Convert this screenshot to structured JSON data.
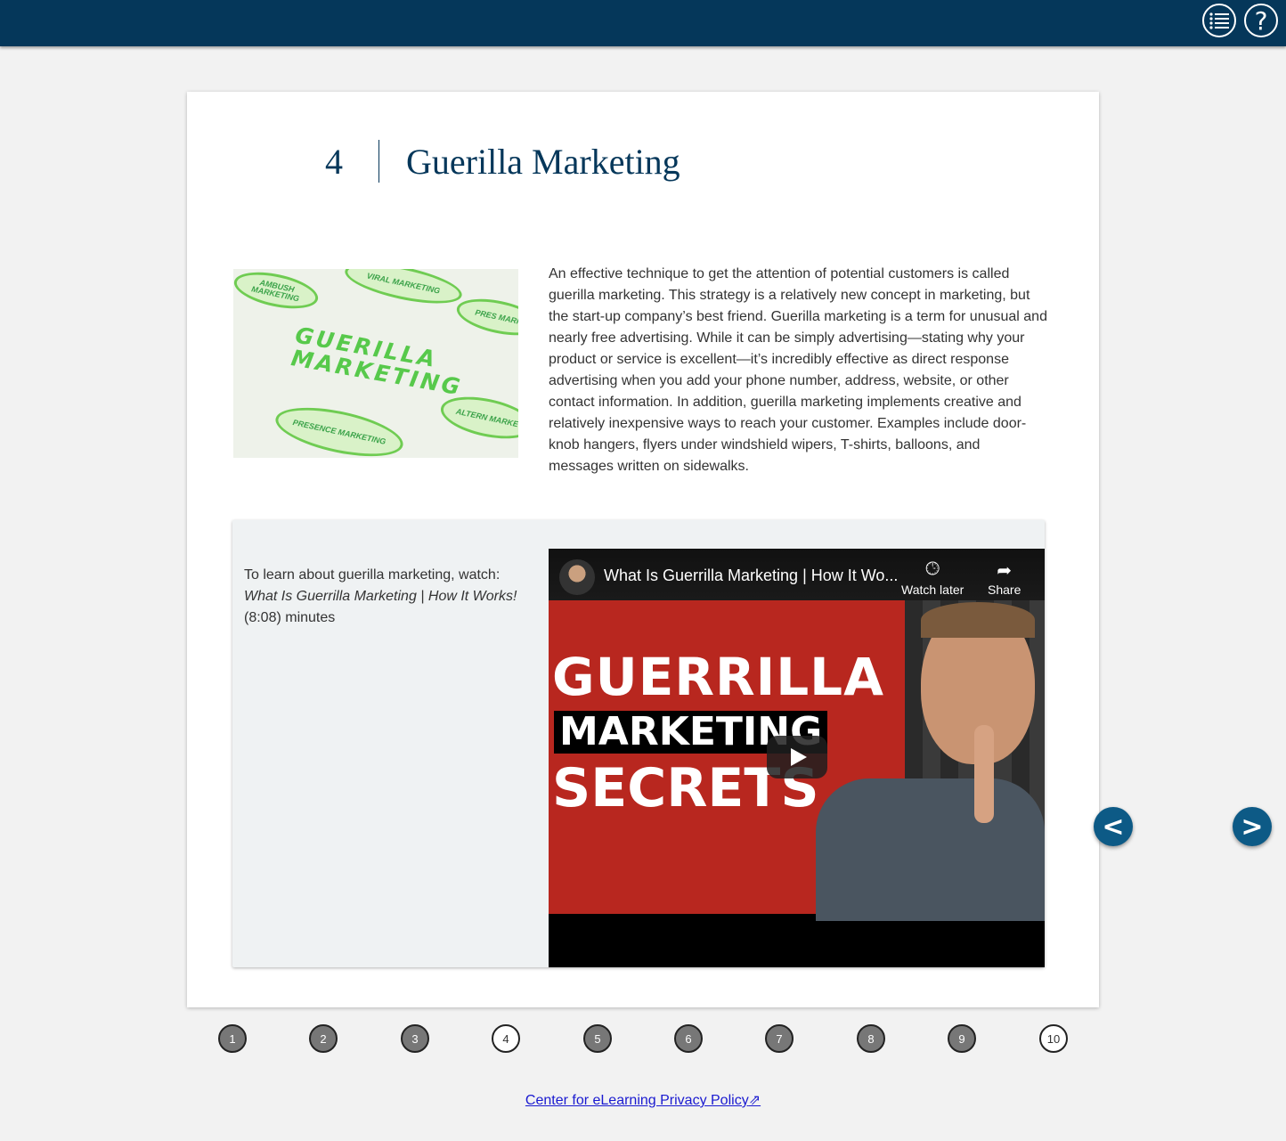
{
  "topbar": {
    "menu_icon": "list-icon",
    "help_label": "?",
    "color": "#05375a"
  },
  "chapter": {
    "number": "4",
    "title": "Guerilla Marketing"
  },
  "hero_image": {
    "main_text_line1": "GUERILLA",
    "main_text_line2": "MARKETING",
    "ovals": [
      "AMBUSH MARKETING",
      "VIRAL MARKETING",
      "PRES MARK",
      "PRESENCE MARKETING",
      "ALTERN MARKE"
    ]
  },
  "paragraph": "An effective technique to get the attention of potential customers is called guerilla marketing. This strategy is a relatively new concept in marketing, but the start-up company’s best friend. Guerilla marketing is a term for unusual and nearly free advertising. While it can be simply advertising—stating why your product or service is excellent—it’s incredibly effective as direct response advertising when you add your phone number, address, website, or other contact information. In addition, guerilla marketing implements creative and relatively inexpensive ways to reach your customer. Examples include door-knob hangers, flyers under windshield wipers, T-shirts, balloons, and messages written on sidewalks.",
  "video": {
    "intro": "To learn about guerilla marketing, watch:",
    "video_name": "What Is Guerrilla Marketing | How It Works!",
    "duration": "(8:08) minutes",
    "player_title": "What Is Guerrilla Marketing | How It Wo...",
    "watch_later": "Watch later",
    "share": "Share",
    "thumb_line1": "GUERRILLA",
    "thumb_line2": "MARKETING",
    "thumb_line3": "SECRETS"
  },
  "nav": {
    "prev": "<",
    "next": ">"
  },
  "pager": {
    "pages": [
      "1",
      "2",
      "3",
      "4",
      "5",
      "6",
      "7",
      "8",
      "9",
      "10"
    ],
    "current": "4"
  },
  "footer": {
    "privacy": "Center for eLearning Privacy Policy"
  }
}
